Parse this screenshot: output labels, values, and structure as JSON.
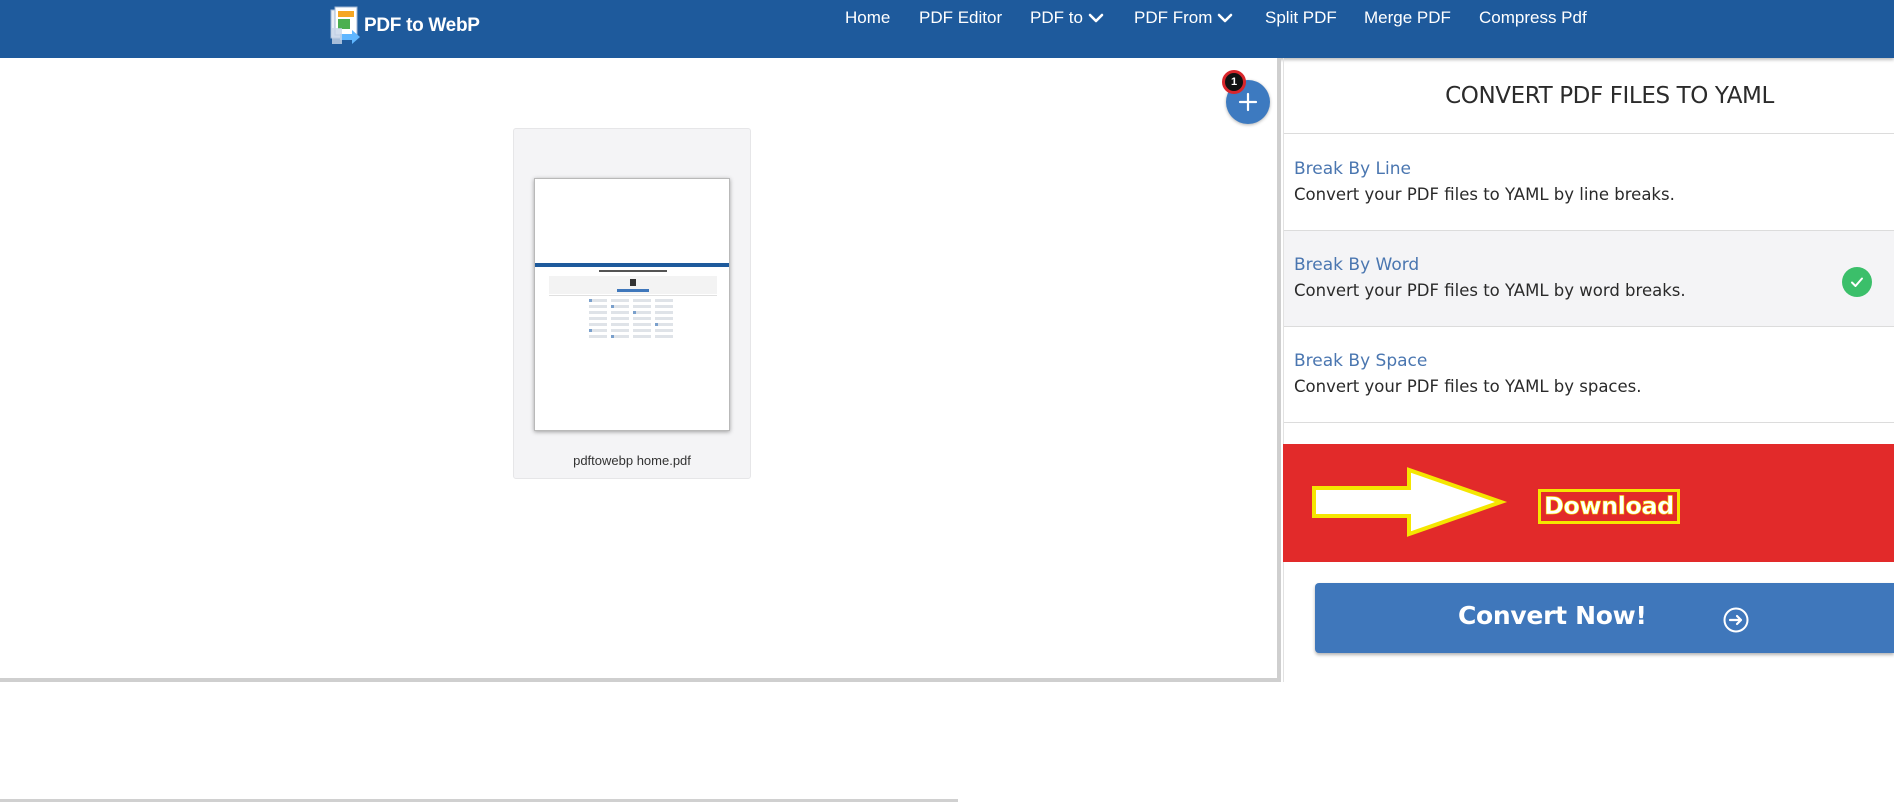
{
  "header": {
    "logo_text": "PDF to WebP",
    "nav": [
      {
        "label": "Home",
        "has_caret": false
      },
      {
        "label": "PDF Editor",
        "has_caret": false
      },
      {
        "label": "PDF to",
        "has_caret": true
      },
      {
        "label": "PDF From",
        "has_caret": true
      },
      {
        "label": "Split PDF",
        "has_caret": false
      },
      {
        "label": "Merge PDF",
        "has_caret": false
      },
      {
        "label": "Compress Pdf",
        "has_caret": false
      }
    ]
  },
  "workspace": {
    "file_count": "1",
    "files": [
      {
        "name": "pdftowebp home.pdf"
      }
    ],
    "add_icon": "plus-icon"
  },
  "panel": {
    "title": "CONVERT PDF FILES TO YAML",
    "options": [
      {
        "title": "Break By Line",
        "description": "Convert your PDF files to YAML by line breaks.",
        "selected": false
      },
      {
        "title": "Break By Word",
        "description": "Convert your PDF files to YAML by word breaks.",
        "selected": true
      },
      {
        "title": "Break By Space",
        "description": "Convert your PDF files to YAML by spaces.",
        "selected": false
      }
    ],
    "download_label": "Download",
    "convert_label": "Convert Now!",
    "convert_icon": "arrow-circle-right-icon"
  },
  "colors": {
    "header_bg": "#1e5a9c",
    "link_blue": "#4a76b0",
    "download_bg": "#e22a2a",
    "highlight_yellow": "#f5e600",
    "convert_bg": "#3f77bb",
    "check_green": "#3bbf6a"
  }
}
